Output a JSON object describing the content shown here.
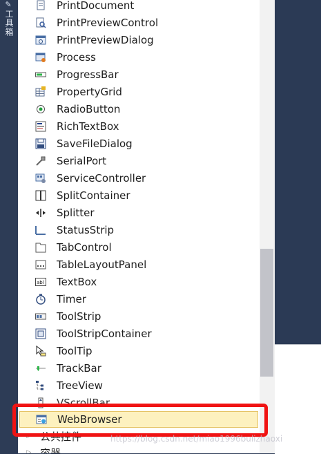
{
  "side_tab": {
    "label": "工具箱"
  },
  "toolbox": {
    "items": [
      {
        "label": "PrintDocument",
        "icon": "print-document-icon"
      },
      {
        "label": "PrintPreviewControl",
        "icon": "print-preview-control-icon"
      },
      {
        "label": "PrintPreviewDialog",
        "icon": "print-preview-dialog-icon"
      },
      {
        "label": "Process",
        "icon": "process-icon"
      },
      {
        "label": "ProgressBar",
        "icon": "progressbar-icon"
      },
      {
        "label": "PropertyGrid",
        "icon": "propertygrid-icon"
      },
      {
        "label": "RadioButton",
        "icon": "radiobutton-icon"
      },
      {
        "label": "RichTextBox",
        "icon": "richtextbox-icon"
      },
      {
        "label": "SaveFileDialog",
        "icon": "savefiledialog-icon"
      },
      {
        "label": "SerialPort",
        "icon": "serialport-icon"
      },
      {
        "label": "ServiceController",
        "icon": "servicecontroller-icon"
      },
      {
        "label": "SplitContainer",
        "icon": "splitcontainer-icon"
      },
      {
        "label": "Splitter",
        "icon": "splitter-icon"
      },
      {
        "label": "StatusStrip",
        "icon": "statusstrip-icon"
      },
      {
        "label": "TabControl",
        "icon": "tabcontrol-icon"
      },
      {
        "label": "TableLayoutPanel",
        "icon": "tablelayoutpanel-icon"
      },
      {
        "label": "TextBox",
        "icon": "textbox-icon"
      },
      {
        "label": "Timer",
        "icon": "timer-icon"
      },
      {
        "label": "ToolStrip",
        "icon": "toolstrip-icon"
      },
      {
        "label": "ToolStripContainer",
        "icon": "toolstripcontainer-icon"
      },
      {
        "label": "ToolTip",
        "icon": "tooltip-icon"
      },
      {
        "label": "TrackBar",
        "icon": "trackbar-icon"
      },
      {
        "label": "TreeView",
        "icon": "treeview-icon"
      },
      {
        "label": "VScrollBar",
        "icon": "vscrollbar-icon"
      }
    ],
    "selected_item": {
      "label": "WebBrowser",
      "icon": "webbrowser-icon"
    },
    "groups": [
      {
        "label": "公共控件"
      },
      {
        "label": "容器"
      }
    ]
  },
  "watermark": "https://blog.csdn.net/miao1996bulizhaoxi",
  "colors": {
    "highlight": "#f01313",
    "selected_bg": "#fdf1bf",
    "chrome": "#2b3a55"
  }
}
